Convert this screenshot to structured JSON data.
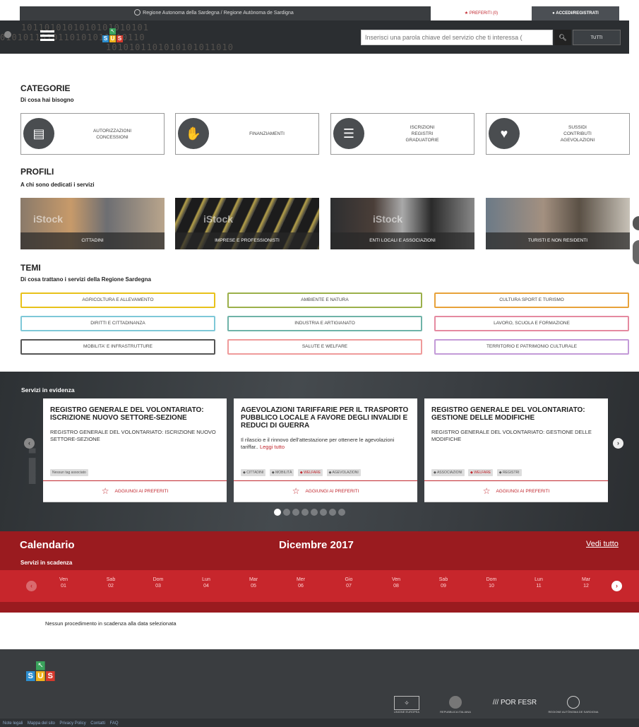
{
  "topbar": {
    "region": "Regione Autonoma della Sardegna / Regione Autònoma de Sardigna",
    "favorites": "PREFERITI (0)",
    "login": "ACCEDI/REGISTRATI"
  },
  "header": {
    "binary_line1": "1011010101010101010101",
    "binary_line2": "0101011010110101011010110",
    "binary_line3": "1010101101010101011010",
    "logo_letters": [
      "S",
      "U",
      "S"
    ],
    "search_placeholder": "Inserisci una parola chiave del servizio che ti interessa (",
    "search_icon": "search-icon",
    "all_label": "TUTTI"
  },
  "categories": {
    "title": "CATEGORIE",
    "subtitle": "Di cosa hai bisogno",
    "items": [
      {
        "label": "AUTORIZZAZIONI\nCONCESSIONI",
        "icon": "document-check-icon"
      },
      {
        "label": "FINANZIAMENTI",
        "icon": "hand-coins-icon"
      },
      {
        "label": "ISCRIZIONI\nREGISTRI\nGRADUATORIE",
        "icon": "list-icon"
      },
      {
        "label": "SUSSIDI\nCONTRIBUTI\nAGEVOLAZIONI",
        "icon": "hand-heart-icon"
      }
    ]
  },
  "profiles": {
    "title": "PROFILI",
    "subtitle": "A chi sono dedicati i servizi",
    "watermark": "iStock",
    "items": [
      {
        "label": "CITTADINI"
      },
      {
        "label": "IMPRESE E PROFESSIONISTI"
      },
      {
        "label": "ENTI LOCALI E ASSOCIAZIONI"
      },
      {
        "label": "TURISTI E NON RESIDENTI"
      }
    ]
  },
  "themes": {
    "title": "TEMI",
    "subtitle": "Di cosa trattano i servizi della Regione Sardegna",
    "items": [
      {
        "label": "AGRICOLTURA E ALLEVAMENTO",
        "color": "#e8c21a"
      },
      {
        "label": "AMBIENTE E NATURA",
        "color": "#9bb04a"
      },
      {
        "label": "CULTURA SPORT E TURISMO",
        "color": "#e8a23a"
      },
      {
        "label": "DIRITTI E CITTADINANZA",
        "color": "#7ec8d8"
      },
      {
        "label": "INDUSTRIA E ARTIGIANATO",
        "color": "#6fb3a8"
      },
      {
        "label": "LAVORO, SCUOLA E FORMAZIONE",
        "color": "#e58aa0"
      },
      {
        "label": "MOBILITA' E INFRASTRUTTURE",
        "color": "#555555"
      },
      {
        "label": "SALUTE E WELFARE",
        "color": "#ef9a9a"
      },
      {
        "label": "TERRITORIO E PATRIMONIO CULTURALE",
        "color": "#c39ad8"
      }
    ]
  },
  "featured": {
    "title": "Servizi in evidenza",
    "add_label": "AGGIUNGI AI PREFERITI",
    "cards": [
      {
        "title": "REGISTRO GENERALE DEL VOLONTARIATO: ISCRIZIONE NUOVO SETTORE-SEZIONE",
        "desc": "REGISTRO GENERALE DEL VOLONTARIATO: ISCRIZIONE NUOVO SETTORE-SEZIONE",
        "more": "",
        "tags": [
          {
            "label": "Nessun tag associato",
            "red": false
          }
        ]
      },
      {
        "title": "AGEVOLAZIONI TARIFFARIE PER IL TRASPORTO PUBBLICO LOCALE A FAVORE DEGLI INVALIDI E REDUCI DI GUERRA",
        "desc": "Il rilascio e il rinnovo dell'attestazione per ottenere le agevolazioni tariffar..",
        "more": " Leggi tutto",
        "tags": [
          {
            "label": "CITTADINI",
            "red": false
          },
          {
            "label": "MOBILITÀ",
            "red": false
          },
          {
            "label": "WELFARE",
            "red": true
          },
          {
            "label": "AGEVOLAZIONI",
            "red": false
          }
        ]
      },
      {
        "title": "REGISTRO GENERALE DEL VOLONTARIATO: GESTIONE DELLE MODIFICHE",
        "desc": "REGISTRO GENERALE DEL VOLONTARIATO: GESTIONE DELLE MODIFICHE",
        "more": "",
        "tags": [
          {
            "label": "ASSOCIAZIONI",
            "red": false
          },
          {
            "label": "WELFARE",
            "red": true
          },
          {
            "label": "REGISTRI",
            "red": false
          }
        ]
      }
    ],
    "dots_count": 8,
    "active_dot": 0
  },
  "calendar": {
    "title": "Calendario",
    "month": "Dicembre 2017",
    "see_all": "Vedi tutto",
    "subtitle": "Servizi in scadenza",
    "days": [
      {
        "name": "Ven",
        "num": "01"
      },
      {
        "name": "Sab",
        "num": "02"
      },
      {
        "name": "Dom",
        "num": "03"
      },
      {
        "name": "Lun",
        "num": "04"
      },
      {
        "name": "Mar",
        "num": "05"
      },
      {
        "name": "Mer",
        "num": "06"
      },
      {
        "name": "Gio",
        "num": "07"
      },
      {
        "name": "Ven",
        "num": "08"
      },
      {
        "name": "Sab",
        "num": "09"
      },
      {
        "name": "Dom",
        "num": "10"
      },
      {
        "name": "Lun",
        "num": "11"
      },
      {
        "name": "Mar",
        "num": "12"
      }
    ],
    "empty_message": "Nessun procedimento in scadenza alla data selezionata"
  },
  "footer": {
    "links": [
      "Note legali",
      "Mappa del sito",
      "Privacy Policy",
      "Contatti",
      "FAQ"
    ],
    "partner_captions": [
      "UNIONE EUROPEA",
      "REPUBBLICA ITALIANA",
      "POR FESR",
      "REGIONE AUTÒNOMA DE SARDIGNA"
    ]
  },
  "colors": {
    "accent": "#c0262d",
    "calendar_bg": "#9a1b1f",
    "calendar_strip": "#c7262c",
    "dark": "#3a3d40"
  }
}
